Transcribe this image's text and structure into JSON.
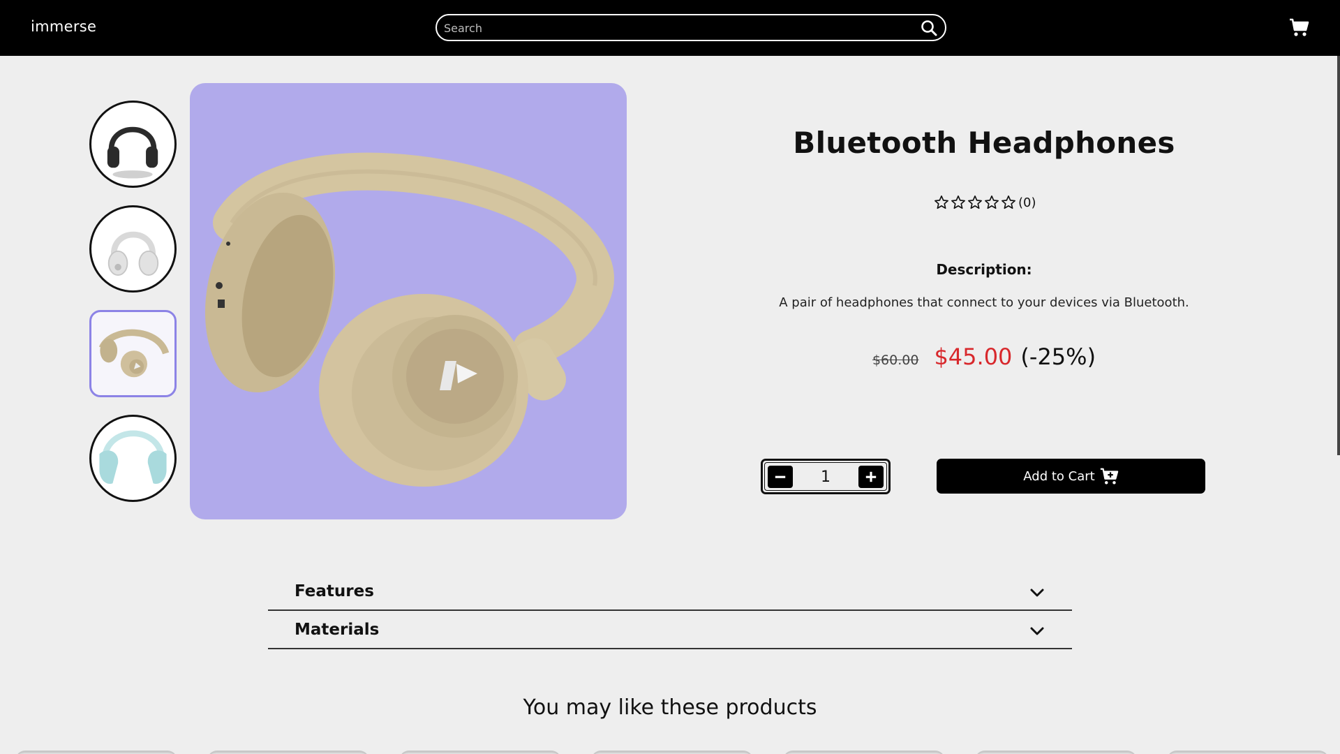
{
  "header": {
    "logo": "immerse",
    "search_placeholder": "Search",
    "search_icon": "search-icon",
    "cart_icon": "cart-icon"
  },
  "gallery": {
    "thumbnails": [
      {
        "name": "black-headphones",
        "color": "#2b2b2b"
      },
      {
        "name": "white-headphones",
        "color": "#d9d9d9"
      },
      {
        "name": "beige-headphones",
        "color": "#cfbf9c",
        "selected": true
      },
      {
        "name": "teal-headphones",
        "color": "#a9dadd"
      }
    ],
    "main_background": "#b1aaeb"
  },
  "product": {
    "title": "Bluetooth Headphones",
    "rating_count": "(0)",
    "rating_value": 0,
    "rating_max": 5,
    "description_label": "Description:",
    "description": "A pair of headphones that connect to your devices via Bluetooth.",
    "old_price": "$60.00",
    "new_price": "$45.00",
    "discount": "(-25%)",
    "quantity": "1",
    "add_to_cart": "Add to Cart"
  },
  "accordions": [
    {
      "label": "Features"
    },
    {
      "label": "Materials"
    }
  ],
  "recommendations": {
    "title": "You may like these products"
  },
  "colors": {
    "accent": "#b1aaeb",
    "selected_border": "#8c83e6",
    "sale_price": "#d8282c"
  }
}
